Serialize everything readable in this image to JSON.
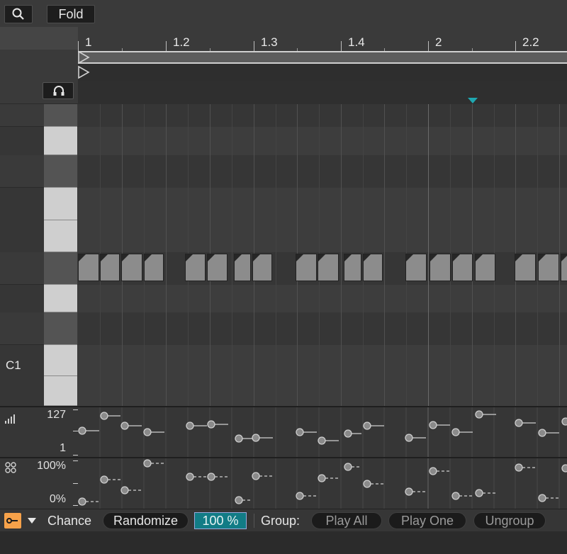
{
  "toolbar": {
    "fold_label": "Fold",
    "search_icon": "search-icon"
  },
  "ruler": {
    "labels": [
      "1",
      "1.2",
      "1.3",
      "1.4",
      "2",
      "2.2"
    ]
  },
  "piano": {
    "octave_label": "C1"
  },
  "velocity_lane": {
    "max_label": "127",
    "min_label": "1"
  },
  "chance_lane": {
    "max_label": "100%",
    "min_label": "0%"
  },
  "bottom": {
    "chance_label": "Chance",
    "randomize_label": "Randomize",
    "chance_value": "100 %",
    "group_label": "Group:",
    "play_all_label": "Play All",
    "play_one_label": "Play One",
    "ungroup_label": "Ungroup"
  },
  "colors": {
    "accent": "#1fa7b0",
    "value_box": "#127c86",
    "note_fill": "#8c8c8c",
    "orange": "#f7a24a"
  }
}
